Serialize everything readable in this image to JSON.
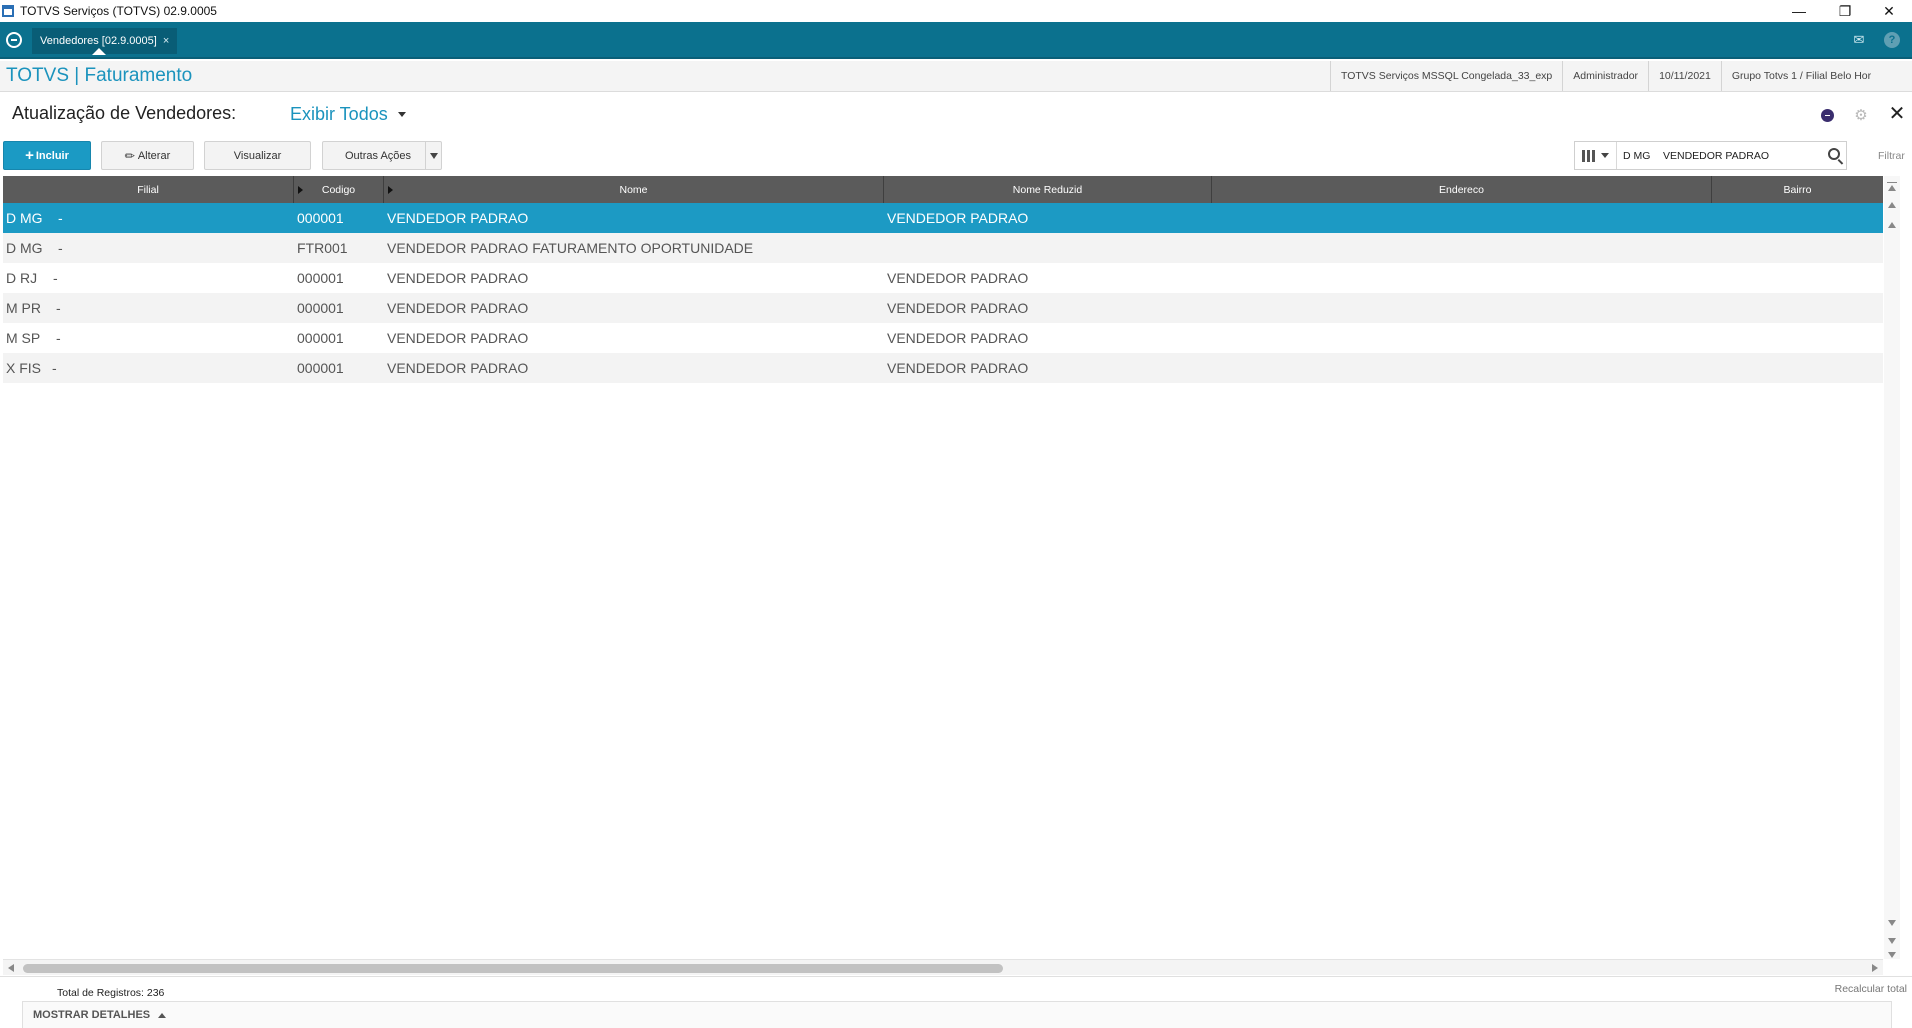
{
  "window": {
    "title": "TOTVS Serviços (TOTVS) 02.9.0005",
    "minimize": "—",
    "restore": "❐",
    "close": "✕"
  },
  "tabstrip": {
    "tab_label": "Vendedores [02.9.0005]",
    "tab_close": "×",
    "mail_icon": "✉",
    "help_icon": "?"
  },
  "module": {
    "title": "TOTVS | Faturamento",
    "environment": "TOTVS Serviços MSSQL Congelada_33_exp",
    "user": "Administrador",
    "date": "10/11/2021",
    "branch": "Grupo Totvs 1 / Filial Belo Hor"
  },
  "browse": {
    "title": "Atualização de Vendedores:",
    "view": "Exibir Todos",
    "gear_icon": "⚙",
    "close_icon": "✕"
  },
  "toolbar": {
    "incluir_plus": "+",
    "incluir": "Incluir",
    "alterar_icon": "✎",
    "alterar": "Alterar",
    "visualizar": "Visualizar",
    "outras": "Outras Ações"
  },
  "search": {
    "filial": "D MG",
    "value": "VENDEDOR PADRAO",
    "filter_label": "Filtrar"
  },
  "grid": {
    "columns": [
      "Filial",
      "Codigo",
      "Nome",
      "Nome Reduzid",
      "Endereco",
      "Bairro"
    ],
    "rows": [
      {
        "filial": "D MG",
        "sep": "-",
        "codigo": "000001",
        "nome": "VENDEDOR PADRAO",
        "reduz": "VENDEDOR PADRAO"
      },
      {
        "filial": "D MG",
        "sep": "-",
        "codigo": "FTR001",
        "nome": "VENDEDOR PADRAO FATURAMENTO OPORTUNIDADE",
        "reduz": ""
      },
      {
        "filial": "D RJ",
        "sep": "-",
        "codigo": "000001",
        "nome": "VENDEDOR PADRAO",
        "reduz": "VENDEDOR PADRAO"
      },
      {
        "filial": "M PR",
        "sep": "-",
        "codigo": "000001",
        "nome": "VENDEDOR PADRAO",
        "reduz": "VENDEDOR PADRAO"
      },
      {
        "filial": "M SP",
        "sep": "-",
        "codigo": "000001",
        "nome": "VENDEDOR PADRAO",
        "reduz": "VENDEDOR PADRAO"
      },
      {
        "filial": "X FIS",
        "sep": "-",
        "codigo": "000001",
        "nome": "VENDEDOR PADRAO",
        "reduz": "VENDEDOR PADRAO"
      }
    ]
  },
  "footer": {
    "total": "Total de Registros: 236",
    "recalc": "Recalcular total",
    "details": "MOSTRAR DETALHES"
  },
  "colors": {
    "accent": "#1b93bd",
    "tabstrip": "#0b718e",
    "selected_row": "#1c9ac4",
    "grid_header": "#5b5b5b"
  }
}
